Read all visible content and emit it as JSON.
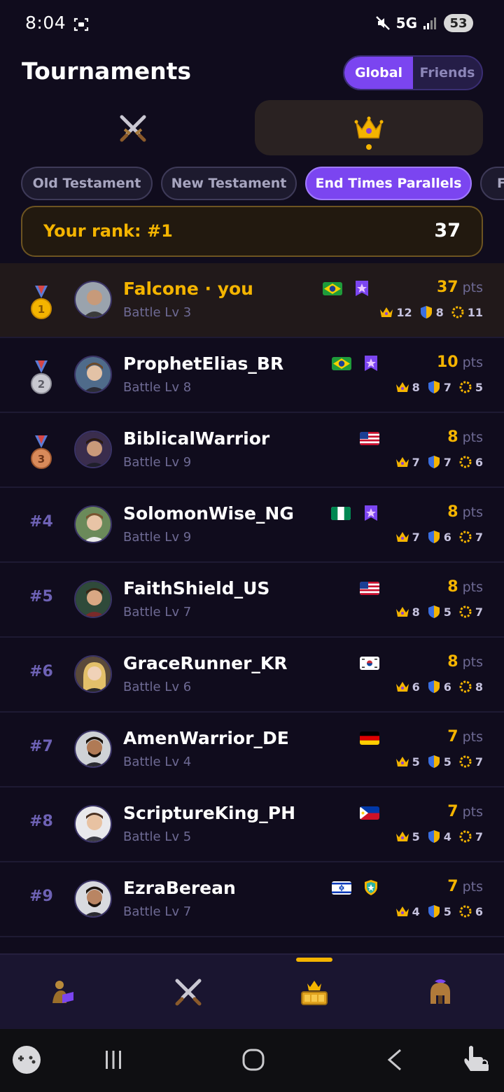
{
  "status_bar": {
    "time": "8:04",
    "network": "5G",
    "battery": "53"
  },
  "header": {
    "title": "Tournaments",
    "scope_tabs": [
      {
        "label": "Global",
        "active": true
      },
      {
        "label": "Friends",
        "active": false
      }
    ]
  },
  "mode_tabs": [
    {
      "icon": "crossed-swords-icon",
      "active": false
    },
    {
      "icon": "crown-icon",
      "active": true
    }
  ],
  "categories": [
    {
      "label": "Old Testament",
      "active": false
    },
    {
      "label": "New Testament",
      "active": false
    },
    {
      "label": "End Times Parallels",
      "active": true
    },
    {
      "label": "F",
      "active": false
    }
  ],
  "your_rank": {
    "label": "Your rank: #1",
    "value": "37"
  },
  "leaderboard": [
    {
      "rank": "1",
      "name": "Falcone · you",
      "level": "Battle Lv 3",
      "country": "BR",
      "badge": "purple-rank-badge",
      "points": "37",
      "pts_unit": "pts",
      "crowns": "12",
      "shields": "8",
      "wreaths": "11",
      "is_me": true
    },
    {
      "rank": "2",
      "name": "ProphetElias_BR",
      "level": "Battle Lv 8",
      "country": "BR",
      "badge": "purple-rank-badge",
      "points": "10",
      "pts_unit": "pts",
      "crowns": "8",
      "shields": "7",
      "wreaths": "5"
    },
    {
      "rank": "3",
      "name": "BiblicalWarrior",
      "level": "Battle Lv 9",
      "country": "US",
      "badge": "",
      "points": "8",
      "pts_unit": "pts",
      "crowns": "7",
      "shields": "7",
      "wreaths": "6"
    },
    {
      "rank": "#4",
      "name": "SolomonWise_NG",
      "level": "Battle Lv 9",
      "country": "NG",
      "badge": "purple-rank-badge",
      "points": "8",
      "pts_unit": "pts",
      "crowns": "7",
      "shields": "6",
      "wreaths": "7"
    },
    {
      "rank": "#5",
      "name": "FaithShield_US",
      "level": "Battle Lv 7",
      "country": "US",
      "badge": "",
      "points": "8",
      "pts_unit": "pts",
      "crowns": "8",
      "shields": "5",
      "wreaths": "7"
    },
    {
      "rank": "#6",
      "name": "GraceRunner_KR",
      "level": "Battle Lv 6",
      "country": "KR",
      "badge": "",
      "points": "8",
      "pts_unit": "pts",
      "crowns": "6",
      "shields": "6",
      "wreaths": "8"
    },
    {
      "rank": "#7",
      "name": "AmenWarrior_DE",
      "level": "Battle Lv 4",
      "country": "DE",
      "badge": "",
      "points": "7",
      "pts_unit": "pts",
      "crowns": "5",
      "shields": "5",
      "wreaths": "7"
    },
    {
      "rank": "#8",
      "name": "ScriptureKing_PH",
      "level": "Battle Lv 5",
      "country": "PH",
      "badge": "",
      "points": "7",
      "pts_unit": "pts",
      "crowns": "5",
      "shields": "4",
      "wreaths": "7"
    },
    {
      "rank": "#9",
      "name": "EzraBerean",
      "level": "Battle Lv 7",
      "country": "IL",
      "badge": "teal-shield-badge",
      "points": "7",
      "pts_unit": "pts",
      "crowns": "4",
      "shields": "5",
      "wreaths": "6"
    }
  ],
  "bottom_nav": [
    {
      "icon": "reader-icon",
      "active": false
    },
    {
      "icon": "crossed-swords-icon",
      "active": false
    },
    {
      "icon": "trophy-crown-icon",
      "active": true
    },
    {
      "icon": "spartan-helmet-icon",
      "active": false
    }
  ],
  "colors": {
    "background": "#100c1d",
    "accent_purple": "#7b45f0",
    "gold": "#f4b400",
    "muted_text": "#6e6a94"
  }
}
